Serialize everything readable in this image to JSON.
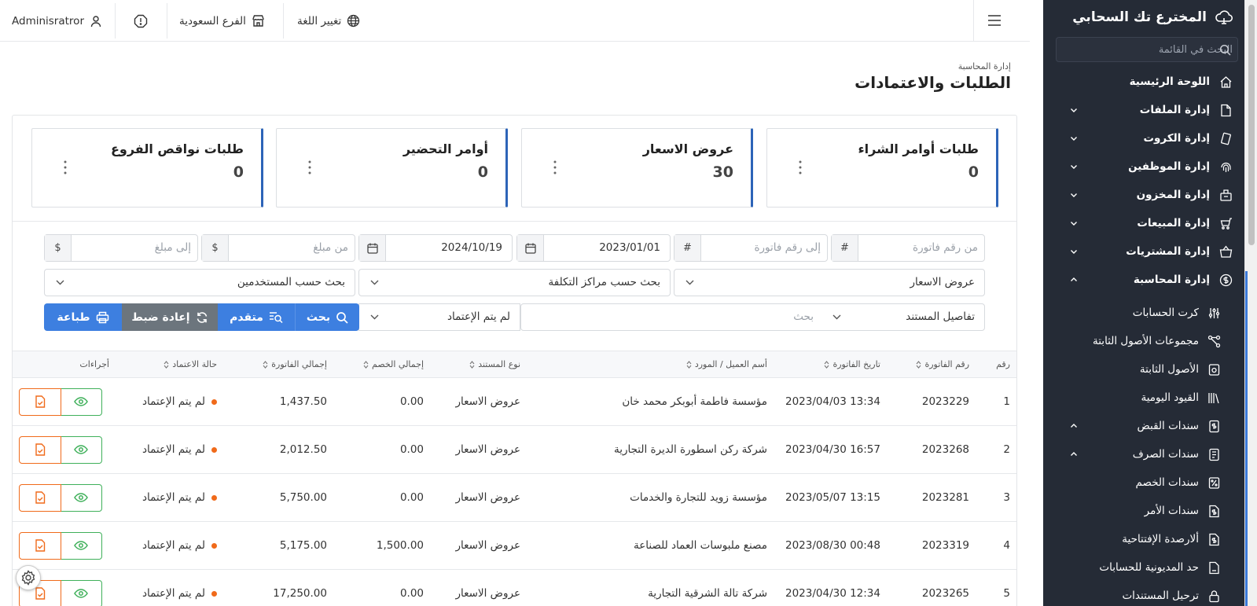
{
  "sidebar": {
    "brand": "المخترع تك السحابي",
    "search_placeholder": "البحث في القائمة",
    "items": [
      {
        "label": "اللوحة الرئيسية",
        "icon": "home-icon"
      },
      {
        "label": "إدارة الملفات",
        "icon": "file-icon"
      },
      {
        "label": "إدارة الكروت",
        "icon": "cards-icon"
      },
      {
        "label": "إدارة الموظفين",
        "icon": "fingerprint-icon"
      },
      {
        "label": "إدارة المخزون",
        "icon": "box-icon"
      },
      {
        "label": "إدارة المبيعات",
        "icon": "cart-icon"
      },
      {
        "label": "إدارة المشتريات",
        "icon": "basket-icon"
      },
      {
        "label": "إدارة المحاسبة",
        "icon": "coin-icon"
      }
    ],
    "subitems": [
      {
        "label": "كرت الحسابات",
        "icon": "sliders-icon"
      },
      {
        "label": "مجموعات الأصول الثابتة",
        "icon": "share-icon"
      },
      {
        "label": "الأصول الثابتة",
        "icon": "asset-icon"
      },
      {
        "label": "القيود اليومية",
        "icon": "books-icon"
      },
      {
        "label": "سندات القبض",
        "icon": "receipt-icon"
      },
      {
        "label": "سندات الصرف",
        "icon": "voucher-icon"
      },
      {
        "label": "سندات الخصم",
        "icon": "discount-icon"
      },
      {
        "label": "سندات الأمر",
        "icon": "order-icon"
      },
      {
        "label": "ألارصدة الإفتتاحية",
        "icon": "balance-icon"
      },
      {
        "label": "حد المديونية للحسابات",
        "icon": "limit-icon"
      },
      {
        "label": "ترحيل المستندات",
        "icon": "lock-icon"
      }
    ]
  },
  "header": {
    "user": "Adminisratror",
    "branch": "الفرع السعودية",
    "language": "تغيير اللغة"
  },
  "page": {
    "breadcrumb": "إدارة المحاسبة",
    "title": "الطلبات والاعتمادات"
  },
  "stats": [
    {
      "title": "طلبات أوامر الشراء",
      "value": "0"
    },
    {
      "title": "عروض الاسعار",
      "value": "30"
    },
    {
      "title": "أوامر التحضير",
      "value": "0"
    },
    {
      "title": "طلبات نواقص الفروع",
      "value": "0"
    }
  ],
  "filters": {
    "from_invoice_placeholder": "من رقم فاتورة",
    "to_invoice_placeholder": "إلى رقم فاتورة",
    "hash": "#",
    "from_date": "2023/01/01",
    "to_date": "2024/10/19",
    "from_amount_placeholder": "من مبلغ",
    "to_amount_placeholder": "إلى مبلغ",
    "currency": "$",
    "doc_type": "عروض الاسعار",
    "cost_center": "بحث حسب مراكز التكلفة",
    "users": "بحث حسب المستخدمين",
    "doc_details": "تفاصيل المستند",
    "search_placeholder": "بحث",
    "approval": "لم يتم الإعتماد"
  },
  "buttons": {
    "search": "بحث",
    "advanced": "متقدم",
    "reset": "إعادة ضبط",
    "print": "طباعة"
  },
  "table": {
    "headers": {
      "num": "رقم",
      "invoice": "رقم الفاتورة",
      "date": "تاريخ الفاتورة",
      "customer": "أسم العميل / المورد",
      "doc_type": "نوع المستند",
      "discount": "إجمالي الخصم",
      "total": "إجمالي الفاتورة",
      "status": "حالة الاعتماد",
      "actions": "أجراءات"
    },
    "rows": [
      {
        "num": "1",
        "invoice": "2023229",
        "date": "2023/04/03 13:34",
        "customer": "مؤسسة فاطمة أبوبكر محمد خان",
        "doc_type": "عروض الاسعار",
        "discount": "0.00",
        "total": "1,437.50",
        "status": "لم يتم الإعتماد"
      },
      {
        "num": "2",
        "invoice": "2023268",
        "date": "2023/04/30 16:57",
        "customer": "شركة ركن اسطورة الديرة التجارية",
        "doc_type": "عروض الاسعار",
        "discount": "0.00",
        "total": "2,012.50",
        "status": "لم يتم الإعتماد"
      },
      {
        "num": "3",
        "invoice": "2023281",
        "date": "2023/05/07 13:15",
        "customer": "مؤسسة زويد للتجارة والخدمات",
        "doc_type": "عروض الاسعار",
        "discount": "0.00",
        "total": "5,750.00",
        "status": "لم يتم الإعتماد"
      },
      {
        "num": "4",
        "invoice": "2023319",
        "date": "2023/08/30 00:48",
        "customer": "مصنع ملبوسات العماد للصناعة",
        "doc_type": "عروض الاسعار",
        "discount": "1,500.00",
        "total": "5,175.00",
        "status": "لم يتم الإعتماد"
      },
      {
        "num": "5",
        "invoice": "2023265",
        "date": "2023/04/30 12:34",
        "customer": "شركة تالة الشرقية التجارية",
        "doc_type": "عروض الاسعار",
        "discount": "0.00",
        "total": "17,250.00",
        "status": "لم يتم الإعتماد"
      }
    ]
  },
  "colors": {
    "sidebar_bg": "#252b36",
    "accent": "#2d64b8",
    "primary_button": "#3d7fe0",
    "secondary_button": "#6c757d",
    "status_dot": "#f06a1a",
    "view_button": "#3fb05a"
  }
}
